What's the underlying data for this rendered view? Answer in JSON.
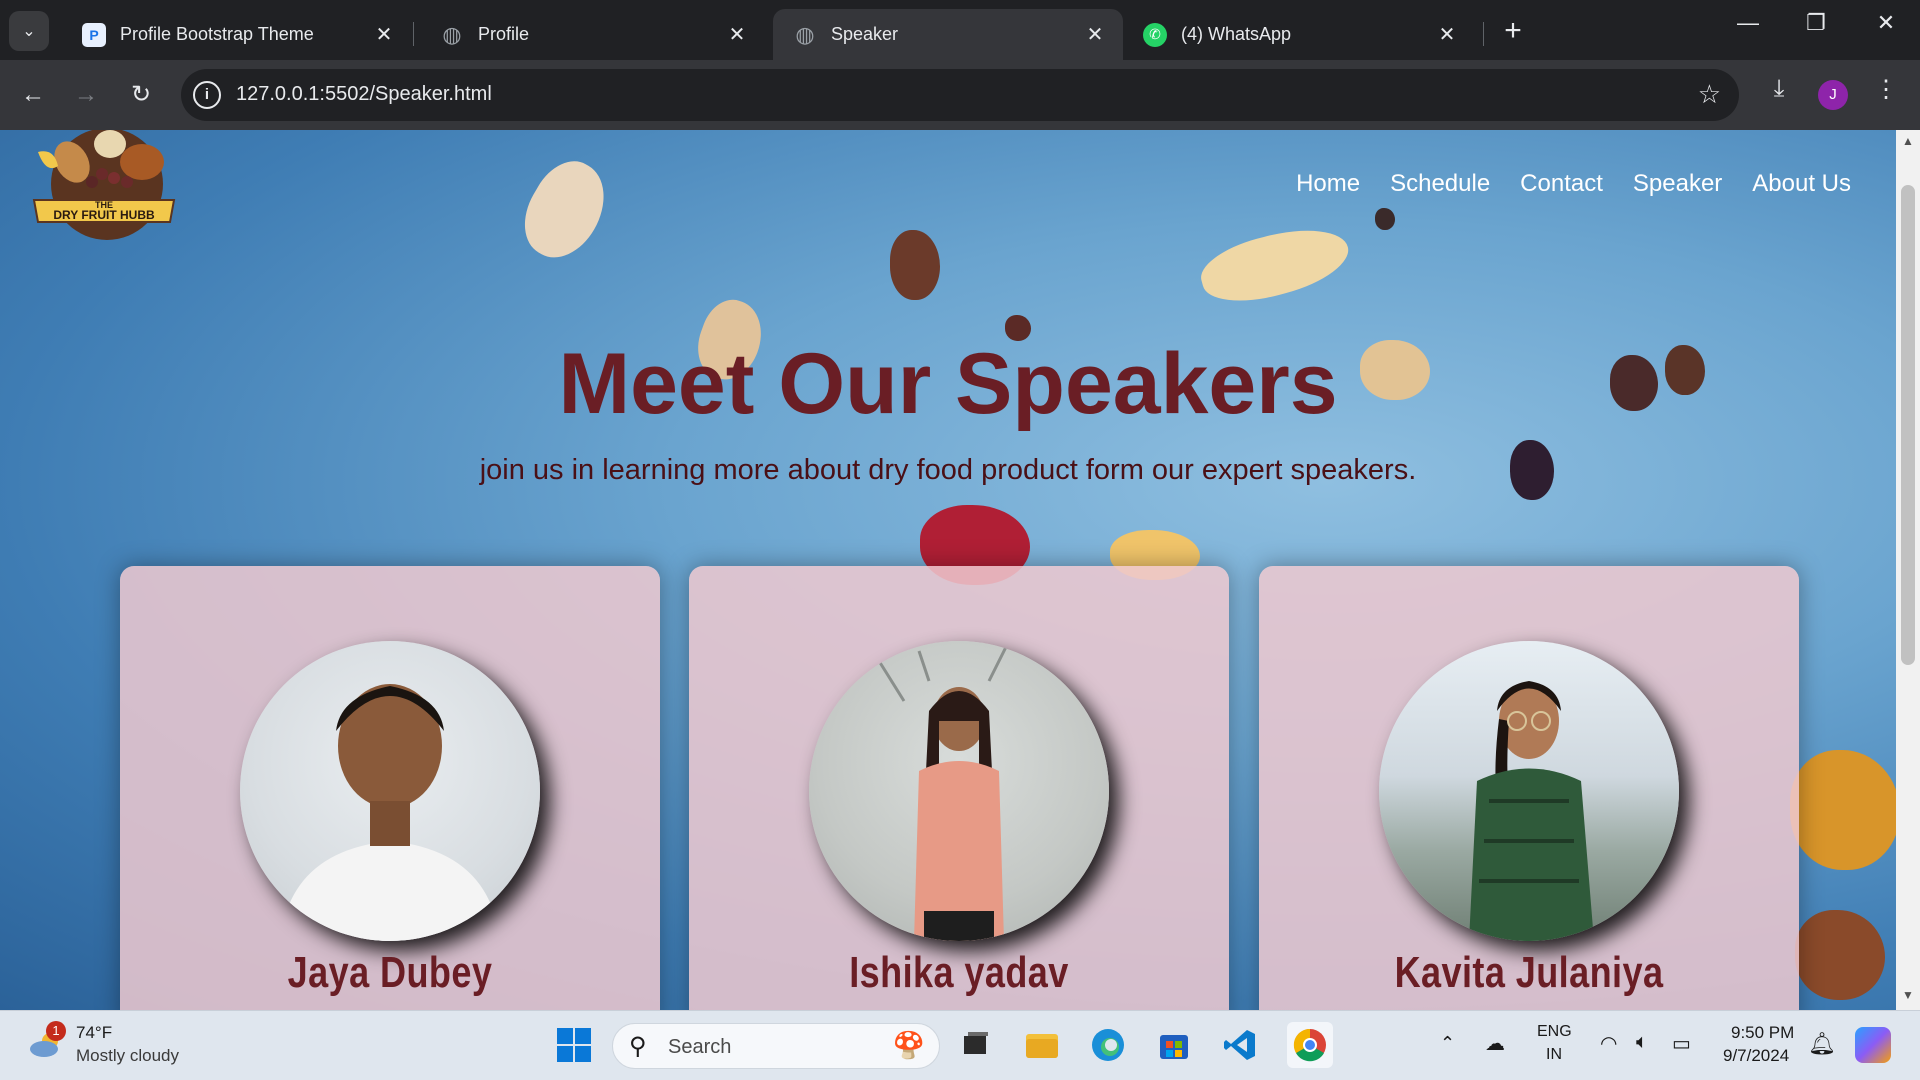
{
  "browser": {
    "tabs": [
      {
        "label": "Profile Bootstrap Theme",
        "icon": "bootstrap-p-icon",
        "active": false
      },
      {
        "label": "Profile",
        "icon": "globe-icon",
        "active": false
      },
      {
        "label": "Speaker",
        "icon": "globe-icon",
        "active": true
      },
      {
        "label": "(4) WhatsApp",
        "icon": "whatsapp-icon",
        "active": false
      }
    ],
    "url": {
      "host": "127.0.0.1",
      "path": ":5502/Speaker.html"
    },
    "avatar_letter": "J"
  },
  "site": {
    "logo_text_top": "THE",
    "logo_text_bottom": "DRY FRUIT HUBB",
    "nav": [
      "Home",
      "Schedule",
      "Contact",
      "Speaker",
      "About Us"
    ],
    "title": "Meet Our Speakers",
    "subtitle": "join us in learning more about dry food product form our expert speakers.",
    "speakers": [
      {
        "name": "Jaya Dubey"
      },
      {
        "name": "Ishika yadav"
      },
      {
        "name": "Kavita Julaniya"
      }
    ]
  },
  "taskbar": {
    "weather_badge": "1",
    "temperature": "74°F",
    "weather": "Mostly cloudy",
    "search_placeholder": "Search",
    "lang_top": "ENG",
    "lang_bottom": "IN",
    "time": "9:50 PM",
    "date": "9/7/2024"
  },
  "colors": {
    "title": "#6a1e25",
    "card": "#eec8cf",
    "sky": "#6aa4cf"
  }
}
